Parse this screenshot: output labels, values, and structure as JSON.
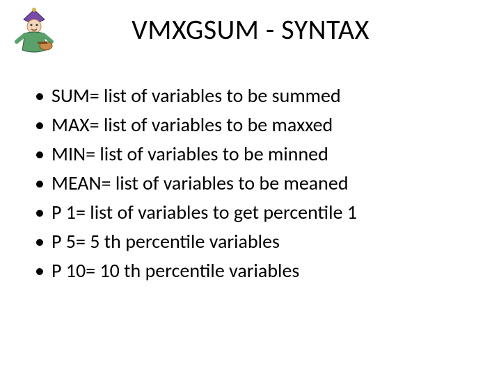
{
  "title": "VMXGSUM - SYNTAX",
  "bullets": [
    "SUM= list of variables to be summed",
    "MAX= list of variables to be maxxed",
    "MIN= list of variables to be minned",
    "MEAN= list of variables to be meaned",
    "P 1= list of variables to get percentile 1",
    "P 5= 5 th percentile variables",
    "P 10= 10 th percentile variables"
  ]
}
